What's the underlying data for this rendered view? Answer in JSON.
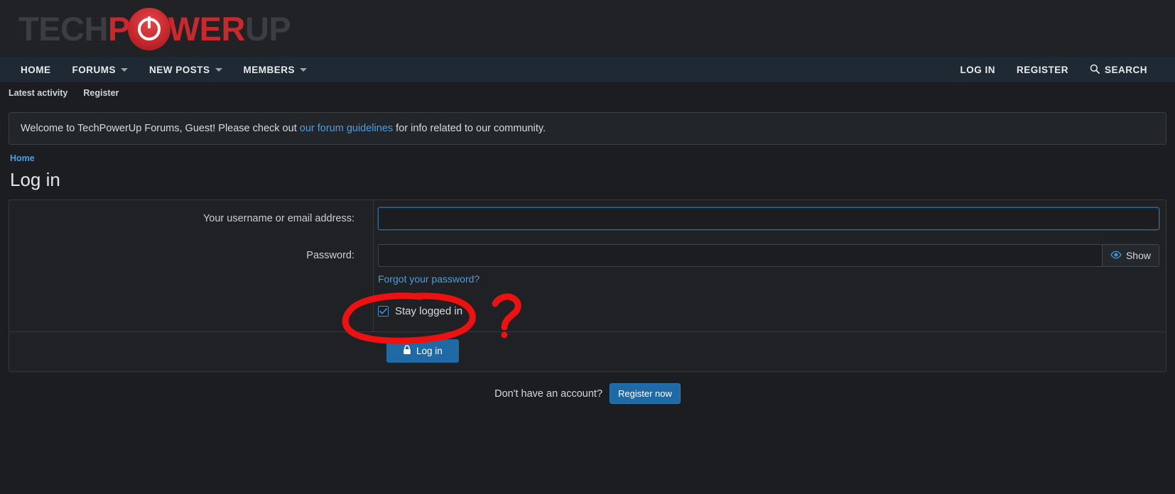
{
  "site": {
    "logo_text_1": "TECH",
    "logo_text_2": "P",
    "logo_icon": "power-icon",
    "logo_text_3": "WER",
    "logo_text_4": "UP"
  },
  "nav": {
    "left_items": [
      {
        "label": "HOME",
        "has_caret": false
      },
      {
        "label": "FORUMS",
        "has_caret": true
      },
      {
        "label": "NEW POSTS",
        "has_caret": true
      },
      {
        "label": "MEMBERS",
        "has_caret": true
      }
    ],
    "right_items": [
      {
        "label": "LOG IN",
        "icon": ""
      },
      {
        "label": "REGISTER",
        "icon": ""
      },
      {
        "label": "SEARCH",
        "icon": "search-icon"
      }
    ]
  },
  "subnav": {
    "items": [
      {
        "label": "Latest activity"
      },
      {
        "label": "Register"
      }
    ]
  },
  "notice": {
    "text_before": "Welcome to TechPowerUp Forums, Guest! Please check out ",
    "link_text": "our forum guidelines",
    "text_after": " for info related to our community."
  },
  "breadcrumb": {
    "home": "Home"
  },
  "page": {
    "title": "Log in"
  },
  "form": {
    "username_label": "Your username or email address:",
    "username_value": "",
    "username_placeholder": "",
    "password_label": "Password:",
    "password_value": "",
    "password_placeholder": "",
    "show_button_label": "Show",
    "show_button_icon": "eye-icon",
    "forgot_link": "Forgot your password?",
    "stay_logged_in_label": "Stay logged in",
    "stay_logged_in_checked": true,
    "login_button_label": "Log in",
    "login_button_icon": "lock-icon"
  },
  "register": {
    "prompt": "Don't have an account?",
    "button_label": "Register now"
  },
  "annotation": {
    "type": "hand-drawn",
    "color": "#ee1111",
    "shapes": [
      "ellipse-around-stay-logged-in",
      "question-mark"
    ]
  },
  "colors": {
    "page_bg": "#1b1d20",
    "nav_bg": "#1f2933",
    "accent_blue": "#4a9fe0",
    "button_blue": "#1f6aa5",
    "logo_red": "#c9282d",
    "annotation_red": "#ee1111"
  }
}
